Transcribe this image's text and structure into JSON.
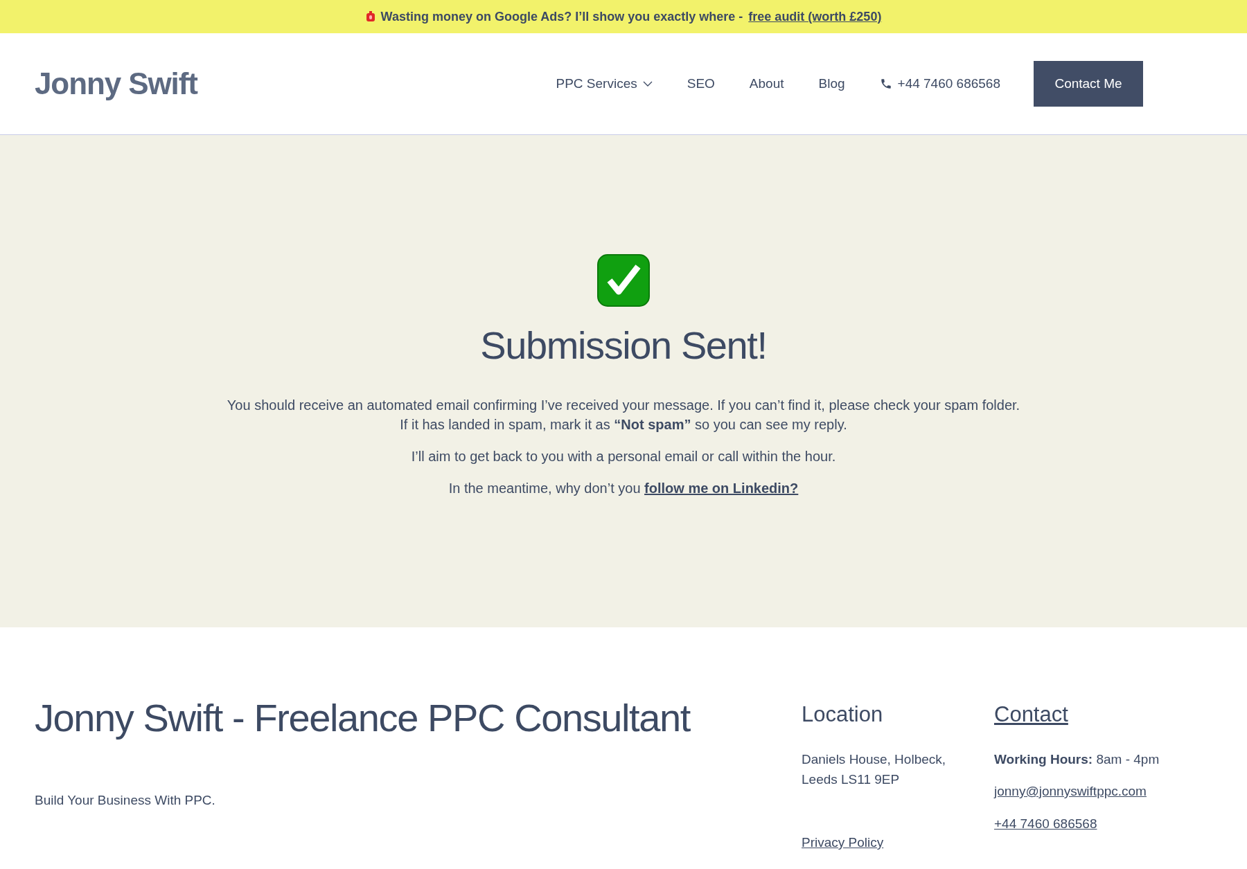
{
  "banner": {
    "text": "**Wasting money on Google Ads? I’ll show you exactly where -**",
    "link": "free audit (worth £250)"
  },
  "header": {
    "logo": "Jonny Swift",
    "nav": [
      {
        "label": "PPC Services",
        "kind": "dropdown"
      },
      {
        "label": "SEO",
        "kind": "link"
      },
      {
        "label": "About",
        "kind": "link"
      },
      {
        "label": "Blog",
        "kind": "link"
      },
      {
        "label": "+44 7460 686568",
        "kind": "phone"
      }
    ],
    "cta": "Contact Me"
  },
  "hero": {
    "title": "Submission Sent!",
    "paragraphs": [
      [
        "You should receive an automated email confirming I’ve received your message. If you can’t find it, please check your spam folder.",
        "If it has landed in spam, mark it as **“Not spam”** so you can see my reply."
      ],
      [
        "I’ll aim to get back to you with a personal email or call within the hour."
      ]
    ],
    "closing": "In the meantime, why don’t you",
    "closing_link": "follow me on Linkedin?"
  },
  "footer": {
    "title": "Jonny Swift - Freelance PPC Consultant",
    "tagline": "Build Your Business With PPC.",
    "location": {
      "heading": "Location",
      "address": [
        "Daniels House, Holbeck,",
        "Leeds LS11 9EP"
      ],
      "link": "Privacy Policy"
    },
    "contact": {
      "heading": "Contact",
      "hours": "**Working Hours:** 8am - 4pm",
      "email": "jonny@jonnyswiftppc.com",
      "phone": "+44 7460 686568"
    }
  }
}
